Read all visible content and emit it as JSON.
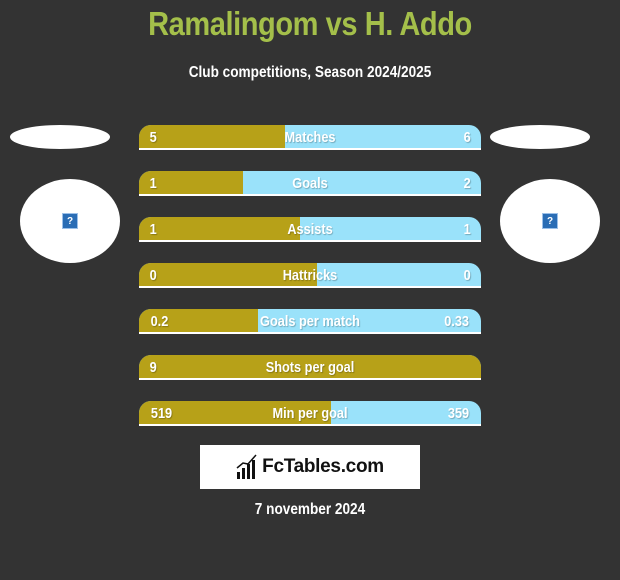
{
  "header": {
    "title": "Ramalingom vs H. Addo",
    "subtitle": "Club competitions, Season 2024/2025"
  },
  "players": {
    "left": {
      "name": "Ramalingom",
      "avatar_icon": "missing-image-icon"
    },
    "right": {
      "name": "H. Addo",
      "avatar_icon": "missing-image-icon"
    }
  },
  "colors": {
    "title": "#a4bf4a",
    "left_bar": "#b7a118",
    "right_bar": "#9ae2fa",
    "background": "#333333"
  },
  "stats": [
    {
      "label": "Matches",
      "left": "5",
      "right": "6",
      "left_fraction": 0.427
    },
    {
      "label": "Goals",
      "left": "1",
      "right": "2",
      "left_fraction": 0.304
    },
    {
      "label": "Assists",
      "left": "1",
      "right": "1",
      "left_fraction": 0.471
    },
    {
      "label": "Hattricks",
      "left": "0",
      "right": "0",
      "left_fraction": 0.52
    },
    {
      "label": "Goals per match",
      "left": "0.2",
      "right": "0.33",
      "left_fraction": 0.348
    },
    {
      "label": "Shots per goal",
      "left": "9",
      "right": "",
      "left_fraction": 1.0
    },
    {
      "label": "Min per goal",
      "left": "519",
      "right": "359",
      "left_fraction": 0.561
    }
  ],
  "footer": {
    "logo_text": "FcTables.com",
    "date": "7 november 2024"
  }
}
